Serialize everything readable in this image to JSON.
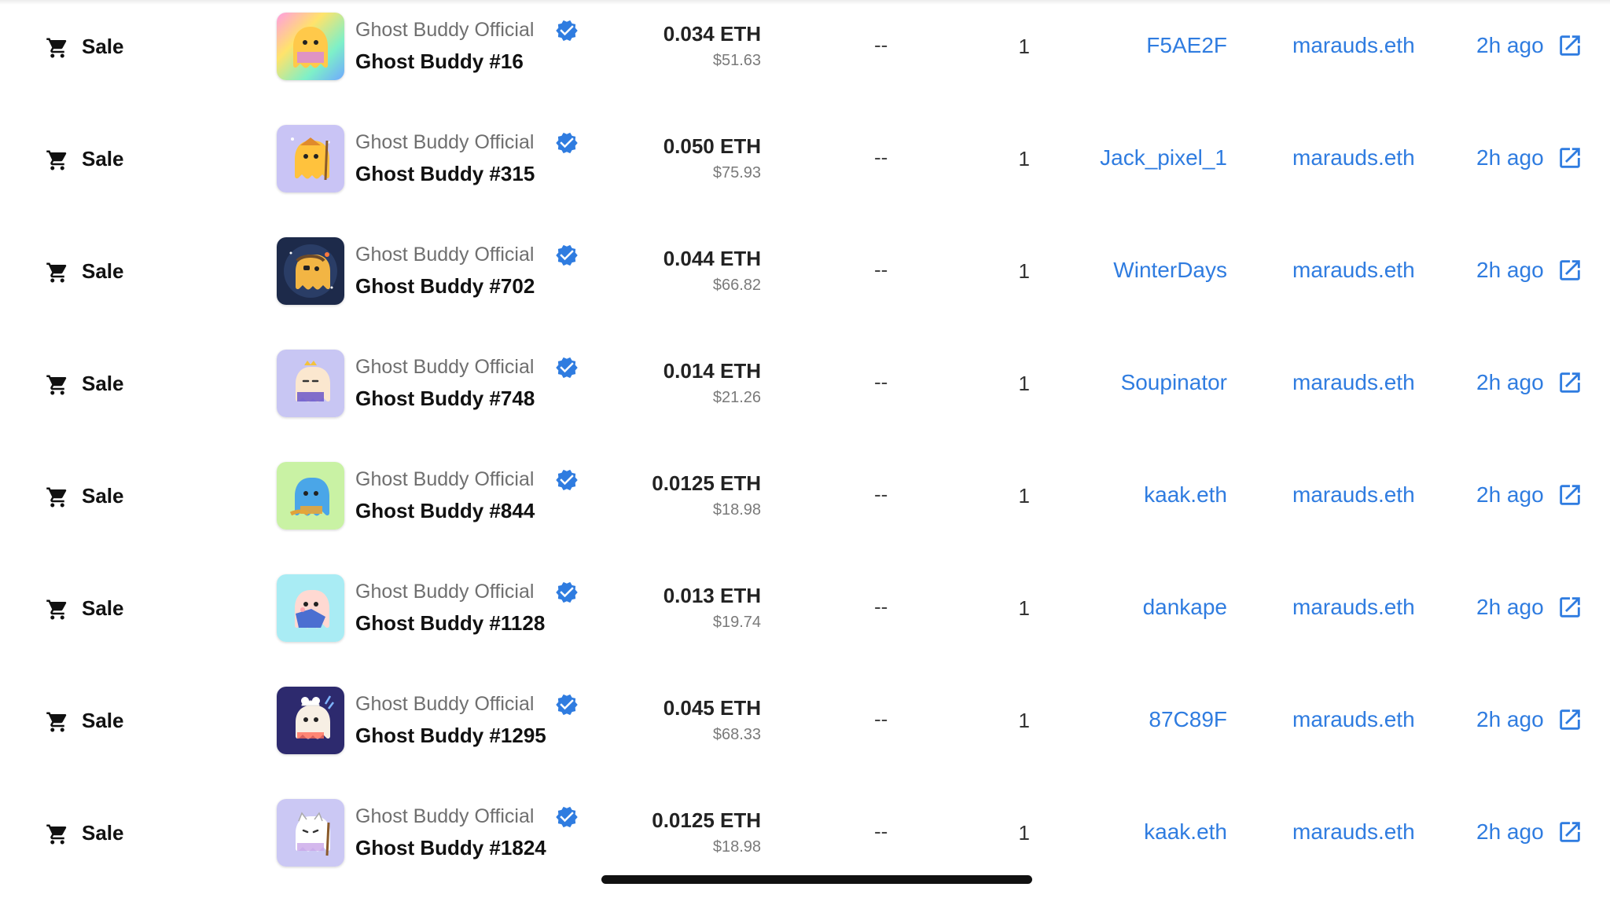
{
  "colors": {
    "link": "#2f7ce0",
    "verified": "#2f7ce0",
    "text": "#111111",
    "muted": "#6f6f6f"
  },
  "icons": {
    "event": "cart-icon",
    "verified": "verified-badge-icon",
    "external": "external-link-icon"
  },
  "rows": [
    {
      "event": "Sale",
      "collection": "Ghost Buddy Official",
      "item": "Ghost Buddy #16",
      "price_eth": "0.034 ETH",
      "price_usd": "$51.63",
      "diff": "--",
      "quantity": "1",
      "from": "F5AE2F",
      "to": "marauds.eth",
      "time": "2h ago"
    },
    {
      "event": "Sale",
      "collection": "Ghost Buddy Official",
      "item": "Ghost Buddy #315",
      "price_eth": "0.050 ETH",
      "price_usd": "$75.93",
      "diff": "--",
      "quantity": "1",
      "from": "Jack_pixel_1",
      "to": "marauds.eth",
      "time": "2h ago"
    },
    {
      "event": "Sale",
      "collection": "Ghost Buddy Official",
      "item": "Ghost Buddy #702",
      "price_eth": "0.044 ETH",
      "price_usd": "$66.82",
      "diff": "--",
      "quantity": "1",
      "from": "WinterDays",
      "to": "marauds.eth",
      "time": "2h ago"
    },
    {
      "event": "Sale",
      "collection": "Ghost Buddy Official",
      "item": "Ghost Buddy #748",
      "price_eth": "0.014 ETH",
      "price_usd": "$21.26",
      "diff": "--",
      "quantity": "1",
      "from": "Soupinator",
      "to": "marauds.eth",
      "time": "2h ago"
    },
    {
      "event": "Sale",
      "collection": "Ghost Buddy Official",
      "item": "Ghost Buddy #844",
      "price_eth": "0.0125 ETH",
      "price_usd": "$18.98",
      "diff": "--",
      "quantity": "1",
      "from": "kaak.eth",
      "to": "marauds.eth",
      "time": "2h ago"
    },
    {
      "event": "Sale",
      "collection": "Ghost Buddy Official",
      "item": "Ghost Buddy #1128",
      "price_eth": "0.013 ETH",
      "price_usd": "$19.74",
      "diff": "--",
      "quantity": "1",
      "from": "dankape",
      "to": "marauds.eth",
      "time": "2h ago"
    },
    {
      "event": "Sale",
      "collection": "Ghost Buddy Official",
      "item": "Ghost Buddy #1295",
      "price_eth": "0.045 ETH",
      "price_usd": "$68.33",
      "diff": "--",
      "quantity": "1",
      "from": "87C89F",
      "to": "marauds.eth",
      "time": "2h ago"
    },
    {
      "event": "Sale",
      "collection": "Ghost Buddy Official",
      "item": "Ghost Buddy #1824",
      "price_eth": "0.0125 ETH",
      "price_usd": "$18.98",
      "diff": "--",
      "quantity": "1",
      "from": "kaak.eth",
      "to": "marauds.eth",
      "time": "2h ago"
    }
  ]
}
